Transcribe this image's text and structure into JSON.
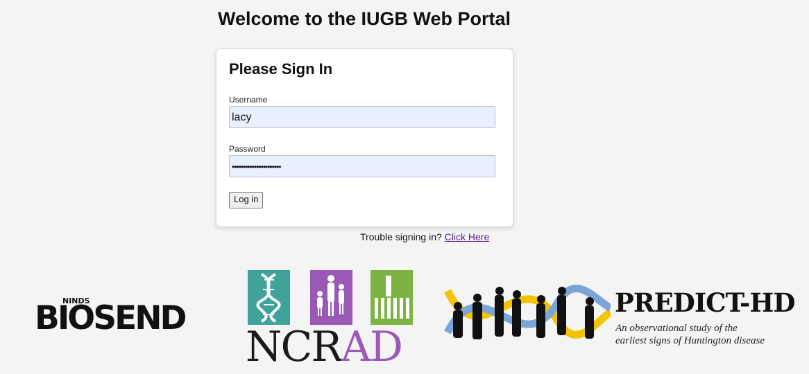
{
  "page": {
    "title": "Welcome to the IUGB Web Portal"
  },
  "login": {
    "heading": "Please Sign In",
    "username_label": "Username",
    "username_value": "lacy",
    "password_label": "Password",
    "password_value": "••••••••••••••••••••••",
    "submit_label": "Log in"
  },
  "help": {
    "prompt": "Trouble signing in?",
    "link_text": "Click Here"
  },
  "logos": {
    "biosend": {
      "ninds": "NINDS",
      "name": "BIOSEND"
    },
    "ncrad": {
      "prefix": "NCR",
      "suffix": "AD",
      "colors": [
        "#3fa39a",
        "#9b59b6",
        "#7cb342"
      ]
    },
    "predict": {
      "name": "PREDICT-HD",
      "tagline_1": "An observational study of the",
      "tagline_2": "earliest signs of Huntington disease"
    }
  }
}
